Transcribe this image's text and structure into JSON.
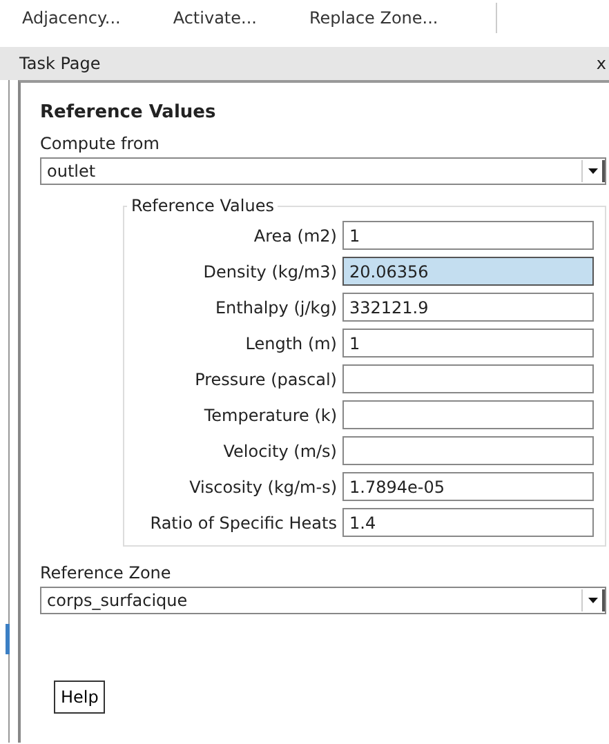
{
  "toolbar": [
    "Adjacency...",
    "Activate...",
    "Replace Zone..."
  ],
  "panel": {
    "title": "Task Page",
    "close": "x"
  },
  "section_title": "Reference Values",
  "compute_from": {
    "label": "Compute from",
    "value": "outlet"
  },
  "group": {
    "title": "Reference Values",
    "fields": [
      {
        "label": "Area (m2)",
        "value": "1",
        "selected": false
      },
      {
        "label": "Density (kg/m3)",
        "value": "20.06356",
        "selected": true
      },
      {
        "label": "Enthalpy (j/kg)",
        "value": "332121.9",
        "selected": false
      },
      {
        "label": "Length (m)",
        "value": "1",
        "selected": false
      },
      {
        "label": "Pressure (pascal)",
        "selected": false
      },
      {
        "label": "Temperature (k)",
        "selected": false
      },
      {
        "label": "Velocity (m/s)",
        "selected": false
      },
      {
        "label": "Viscosity (kg/m-s)",
        "value": "1.7894e-05",
        "selected": false
      },
      {
        "label": "Ratio of Specific Heats",
        "value": "1.4",
        "selected": false
      }
    ]
  },
  "reference_zone": {
    "label": "Reference Zone",
    "value": "corps_surfacique"
  },
  "buttons": [
    "Help"
  ]
}
